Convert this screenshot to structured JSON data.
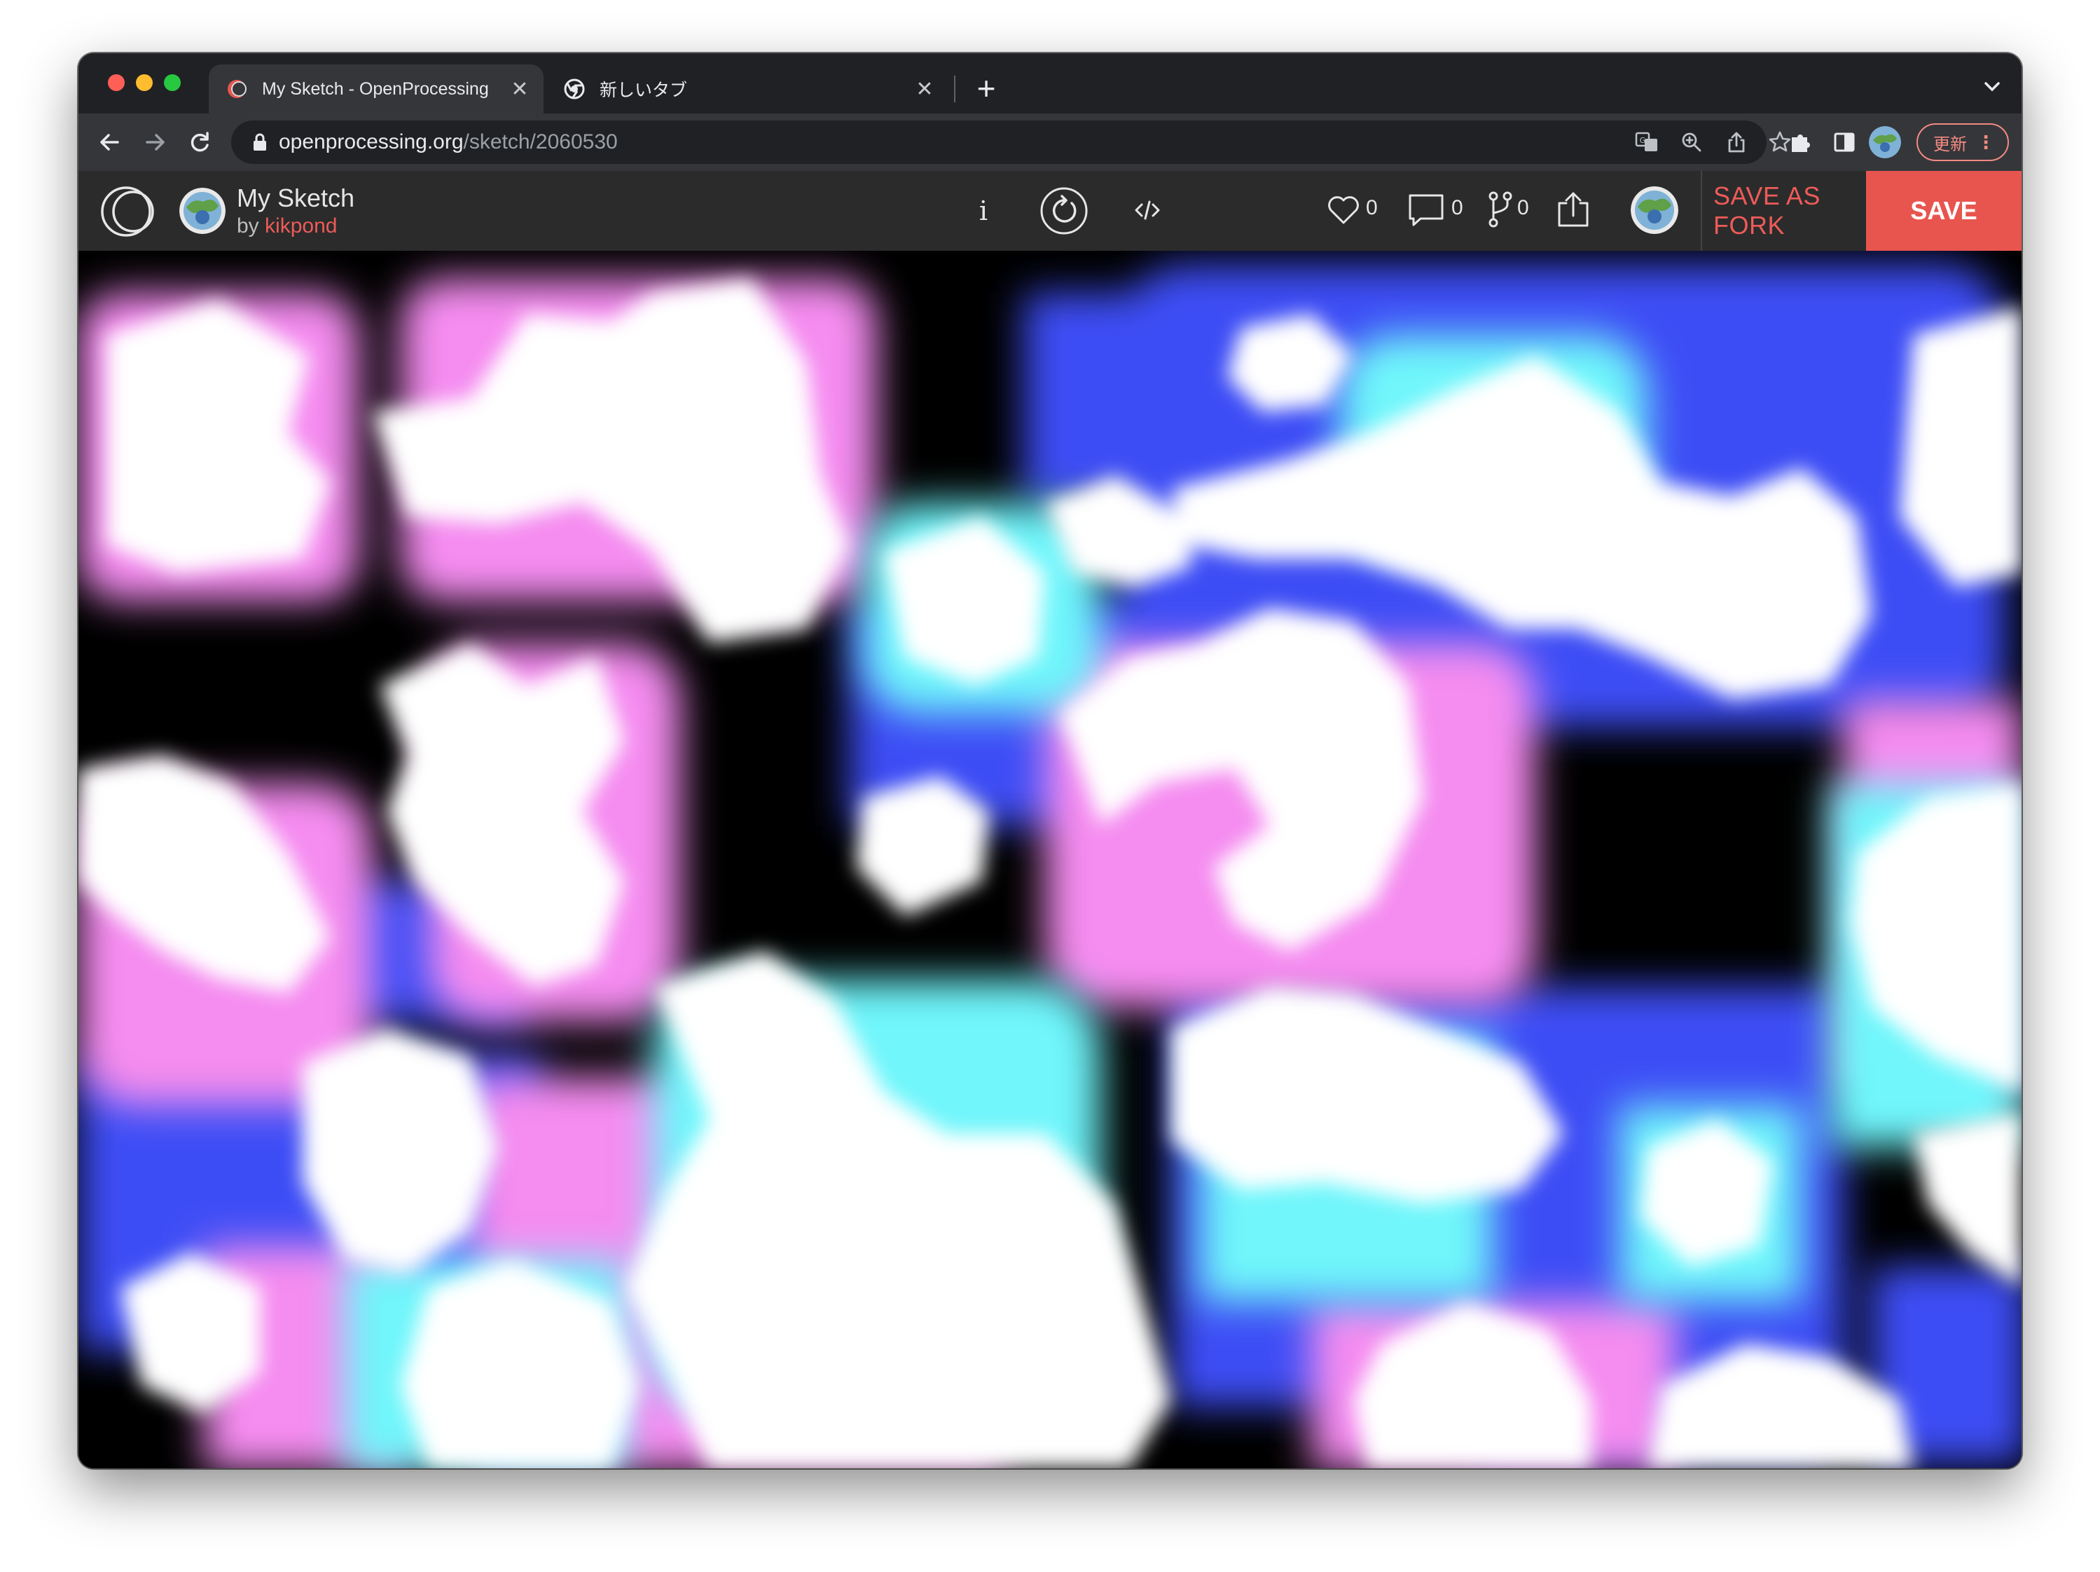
{
  "browser": {
    "tabs": [
      {
        "title": "My Sketch - OpenProcessing",
        "active": true,
        "close": "✕",
        "favicon": "openprocessing-favicon"
      },
      {
        "title": "新しいタブ",
        "active": false,
        "close": "✕",
        "favicon": "chrome-favicon"
      }
    ],
    "new_tab": "+",
    "address": {
      "host": "openprocessing.org",
      "path": "/sketch/2060530"
    },
    "update_label": "更新",
    "menu_dots": "⋮"
  },
  "sketch": {
    "title": "My Sketch",
    "by_prefix": "by",
    "author": "kikpond",
    "info_label": "i",
    "likes": "0",
    "comments": "0",
    "forks": "0",
    "save_as_fork": "SAVE AS FORK",
    "save": "SAVE"
  },
  "colors": {
    "accent": "#e8554f",
    "author": "#ed5b58",
    "canvas_bg": "#000000",
    "blob_white": "#ffffff",
    "blob_pink": "#f58cf0",
    "blob_cyan": "#6ff6fb",
    "blob_blue": "#3d4ef5"
  }
}
